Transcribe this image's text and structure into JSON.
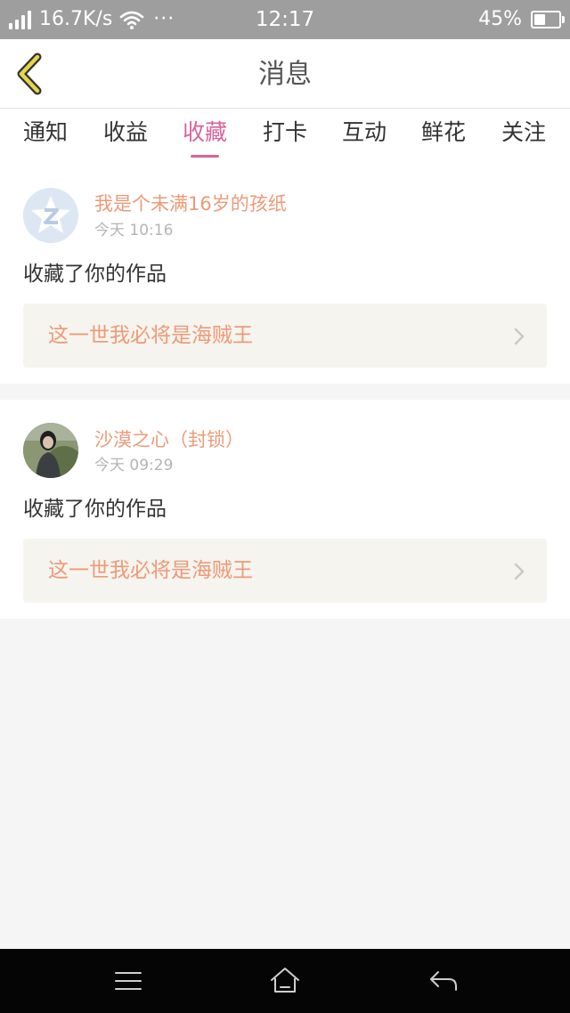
{
  "status_bar": {
    "net_speed": "16.7K/s",
    "more": "···",
    "time": "12:17",
    "battery": "45%",
    "battery_level": 0.45
  },
  "header": {
    "back_icon": "chevron-left-icon",
    "title": "消息"
  },
  "tabs": [
    {
      "label": "通知",
      "active": false
    },
    {
      "label": "收益",
      "active": false
    },
    {
      "label": "收藏",
      "active": true
    },
    {
      "label": "打卡",
      "active": false
    },
    {
      "label": "互动",
      "active": false
    },
    {
      "label": "鲜花",
      "active": false
    },
    {
      "label": "关注",
      "active": false
    }
  ],
  "messages": [
    {
      "avatar": "default-avatar-icon",
      "username": "我是个未满16岁的孩纸",
      "time": "今天 10:16",
      "action": "收藏了你的作品",
      "work_title": "这一世我必将是海贼王"
    },
    {
      "avatar": "user-photo-avatar",
      "username": "沙漠之心（封锁）",
      "time": "今天 09:29",
      "action": "收藏了你的作品",
      "work_title": "这一世我必将是海贼王"
    }
  ],
  "nav_bar": {
    "menu_icon": "menu-icon",
    "home_icon": "home-icon",
    "back_icon": "back-arrow-icon"
  },
  "colors": {
    "accent_pink": "#d7649b",
    "username_orange": "#ee9a78",
    "back_chevron": "#e3d64a"
  }
}
